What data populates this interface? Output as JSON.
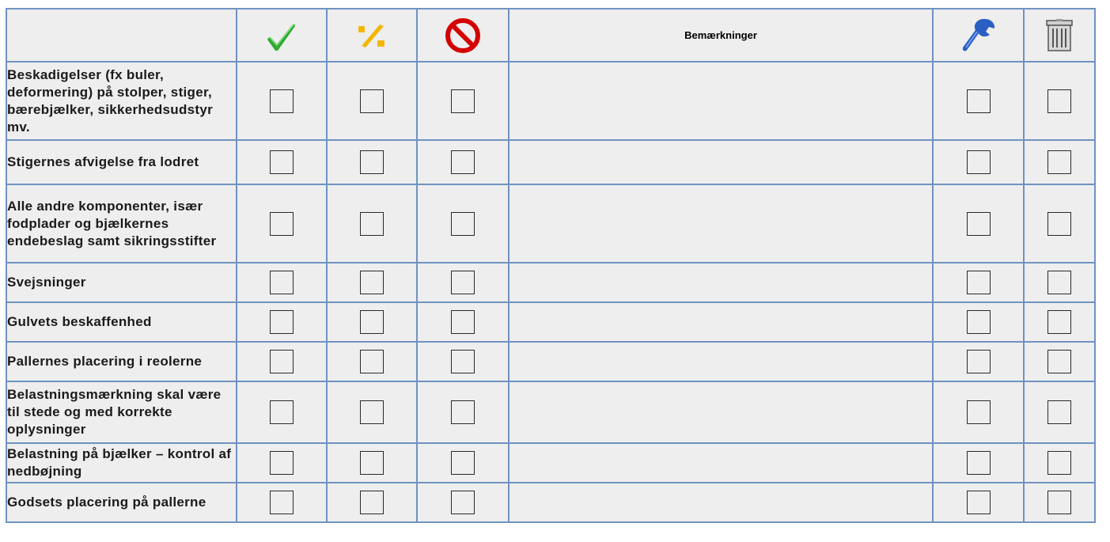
{
  "header": {
    "notes_label": "Bemærkninger",
    "icons": [
      "checkmark-icon",
      "percent-icon",
      "prohibited-icon",
      "wrench-icon",
      "trash-can-icon"
    ],
    "icon_colors": {
      "ok": "#2eaa2e",
      "partial": "#f2b705",
      "fail": "#d40000",
      "repair": "#2a5fc4",
      "discard": "#666666"
    }
  },
  "rows": [
    {
      "label": "Beskadigelser (fx buler, deformering) på stolper, stiger, bærebjælker, sikkerhedsudstyr mv."
    },
    {
      "label": "Stigernes afvigelse fra lodret"
    },
    {
      "label": "Alle andre komponenter, især fodplader og bjælkernes endebeslag samt sikringsstifter"
    },
    {
      "label": "Svejsninger"
    },
    {
      "label": "Gulvets beskaffenhed"
    },
    {
      "label": "Pallernes placering i reolerne"
    },
    {
      "label": "Belastningsmærkning skal være til stede og med korrekte oplysninger"
    },
    {
      "label": "Belastning på bjælker – kontrol af nedbøjning"
    },
    {
      "label": "Godsets placering på pallerne"
    }
  ],
  "colors": {
    "border": "#6f93c1",
    "label_bg": "#f5e8dc",
    "cell_bg": "#eeeeee"
  }
}
